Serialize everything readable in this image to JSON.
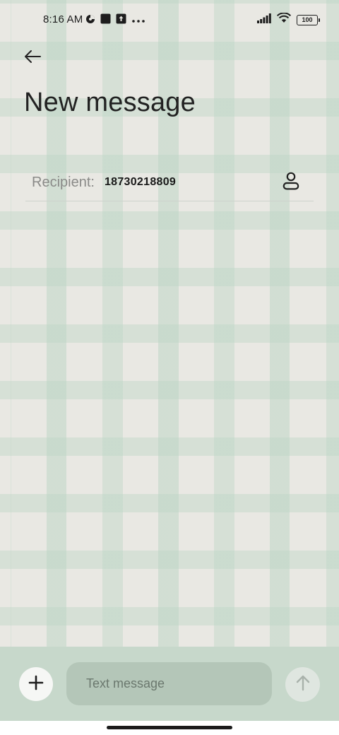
{
  "status_bar": {
    "time": "8:16 AM",
    "battery_level": "100",
    "left_icons": [
      "data-saver-icon",
      "notification-square-icon",
      "upload-icon",
      "more-dots-icon"
    ],
    "right_icons": [
      "signal-icon",
      "wifi-icon",
      "battery-icon"
    ]
  },
  "header": {
    "back_icon": "arrow-left-icon",
    "title": "New message"
  },
  "recipient": {
    "label": "Recipient:",
    "value": "18730218809",
    "contact_icon": "person-icon"
  },
  "composer": {
    "add_icon": "plus-icon",
    "placeholder": "Text message",
    "value": "",
    "send_icon": "arrow-up-icon"
  },
  "colors": {
    "wallpaper_base": "#e9e8e3",
    "wallpaper_stripe": "#bed6c6",
    "composer_bg": "#c7d8cb",
    "input_bg": "#b4c6b8"
  }
}
